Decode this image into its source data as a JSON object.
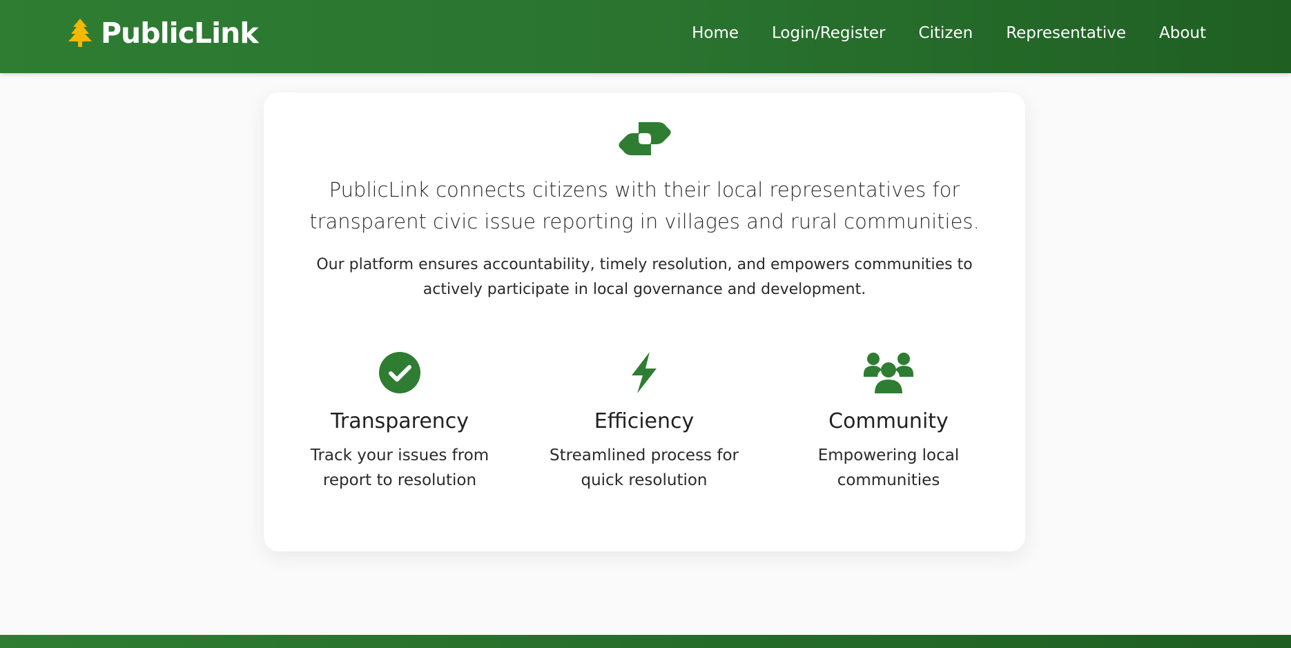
{
  "brand": {
    "name": "PublicLink",
    "icon": "tree-icon",
    "icon_color": "#f5b800"
  },
  "nav": {
    "items": [
      {
        "label": "Home"
      },
      {
        "label": "Login/Register"
      },
      {
        "label": "Citizen"
      },
      {
        "label": "Representative"
      },
      {
        "label": "About"
      }
    ]
  },
  "hero": {
    "icon": "handshake-icon",
    "lead": "PublicLink connects citizens with their local representatives for transparent civic issue reporting in villages and rural communities.",
    "sub": "Our platform ensures accountability, timely resolution, and empowers communities to actively participate in local governance and development."
  },
  "features": [
    {
      "icon": "check-circle-icon",
      "title": "Transparency",
      "text": "Track your issues from report to resolution"
    },
    {
      "icon": "lightning-bolt-icon",
      "title": "Efficiency",
      "text": "Streamlined process for quick resolution"
    },
    {
      "icon": "users-icon",
      "title": "Community",
      "text": "Empowering local communities"
    }
  ],
  "colors": {
    "primary": "#2e7d32",
    "primary_dark": "#1f5f22",
    "accent": "#f5b800",
    "text": "#222222"
  }
}
